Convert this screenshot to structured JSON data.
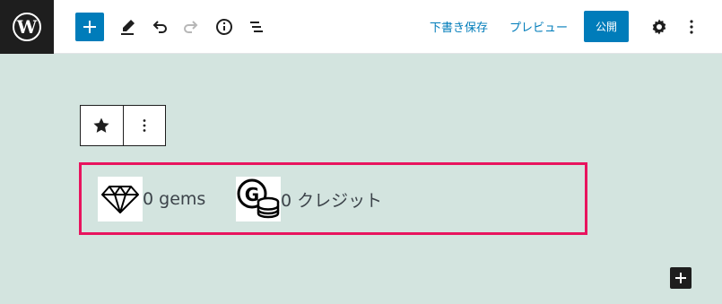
{
  "header": {
    "save_draft_label": "下書き保存",
    "preview_label": "プレビュー",
    "publish_label": "公開"
  },
  "block": {
    "items": [
      {
        "icon": "diamond-icon",
        "value": "0 gems"
      },
      {
        "icon": "coin-stack-icon",
        "value": "0 クレジット"
      }
    ]
  },
  "colors": {
    "accent": "#007cba",
    "canvas": "#d3e4df",
    "highlight": "#e8145e",
    "dark": "#1e1e1e"
  }
}
